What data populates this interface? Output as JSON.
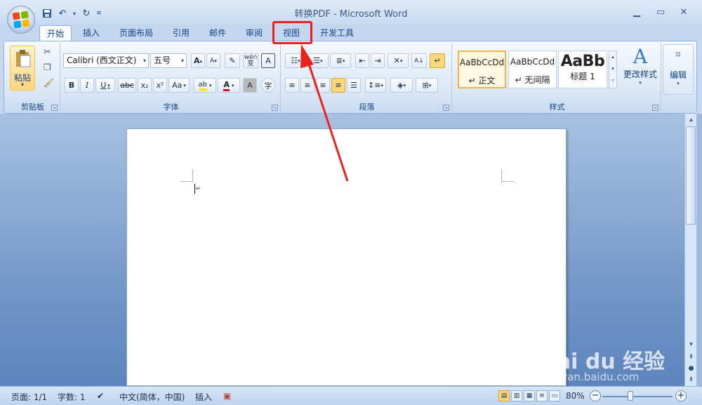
{
  "window": {
    "title": "转换PDF - Microsoft Word",
    "minimize_icon": "minimize-icon",
    "maximize_icon": "maximize-icon",
    "close_icon": "close-icon"
  },
  "quick_access": {
    "save_icon": "save-icon",
    "undo_icon": "undo-icon",
    "redo_icon": "redo-icon",
    "customize_icon": "customize-qat-icon"
  },
  "tabs": [
    {
      "label": "开始",
      "active": true
    },
    {
      "label": "插入"
    },
    {
      "label": "页面布局"
    },
    {
      "label": "引用"
    },
    {
      "label": "邮件"
    },
    {
      "label": "审阅"
    },
    {
      "label": "视图",
      "highlighted": true
    },
    {
      "label": "开发工具"
    }
  ],
  "ribbon": {
    "clipboard": {
      "label": "剪贴板",
      "paste_label": "粘贴"
    },
    "font": {
      "label": "字体",
      "font_name": "Calibri (西文正文)",
      "font_size": "五号",
      "bold": "B",
      "italic": "I",
      "underline": "U",
      "strike": "abc",
      "subscript": "x₂",
      "superscript": "x²",
      "change_case": "Aa",
      "grow": "A",
      "shrink": "A",
      "font_color_letter": "A",
      "highlight_letter": "ab",
      "phonetic": "wén",
      "border_letter": "A",
      "enclose_char": "字"
    },
    "paragraph": {
      "label": "段落"
    },
    "styles": {
      "label": "样式",
      "items": [
        {
          "sample": "AaBbCcDd",
          "name": "↵ 正文",
          "selected": true
        },
        {
          "sample": "AaBbCcDd",
          "name": "↵ 无间隔"
        },
        {
          "sample": "AaBb",
          "name": "标题 1"
        }
      ],
      "change_styles": "更改样式"
    },
    "editing": {
      "label": "编辑"
    }
  },
  "statusbar": {
    "page": "页面: 1/1",
    "words": "字数: 1",
    "language": "中文(简体，中国)",
    "insert_mode": "插入",
    "zoom": "80%",
    "zoom_level": 0.4
  },
  "watermark": {
    "text": "Bai du 经验",
    "url": "jingyan.baidu.com"
  }
}
